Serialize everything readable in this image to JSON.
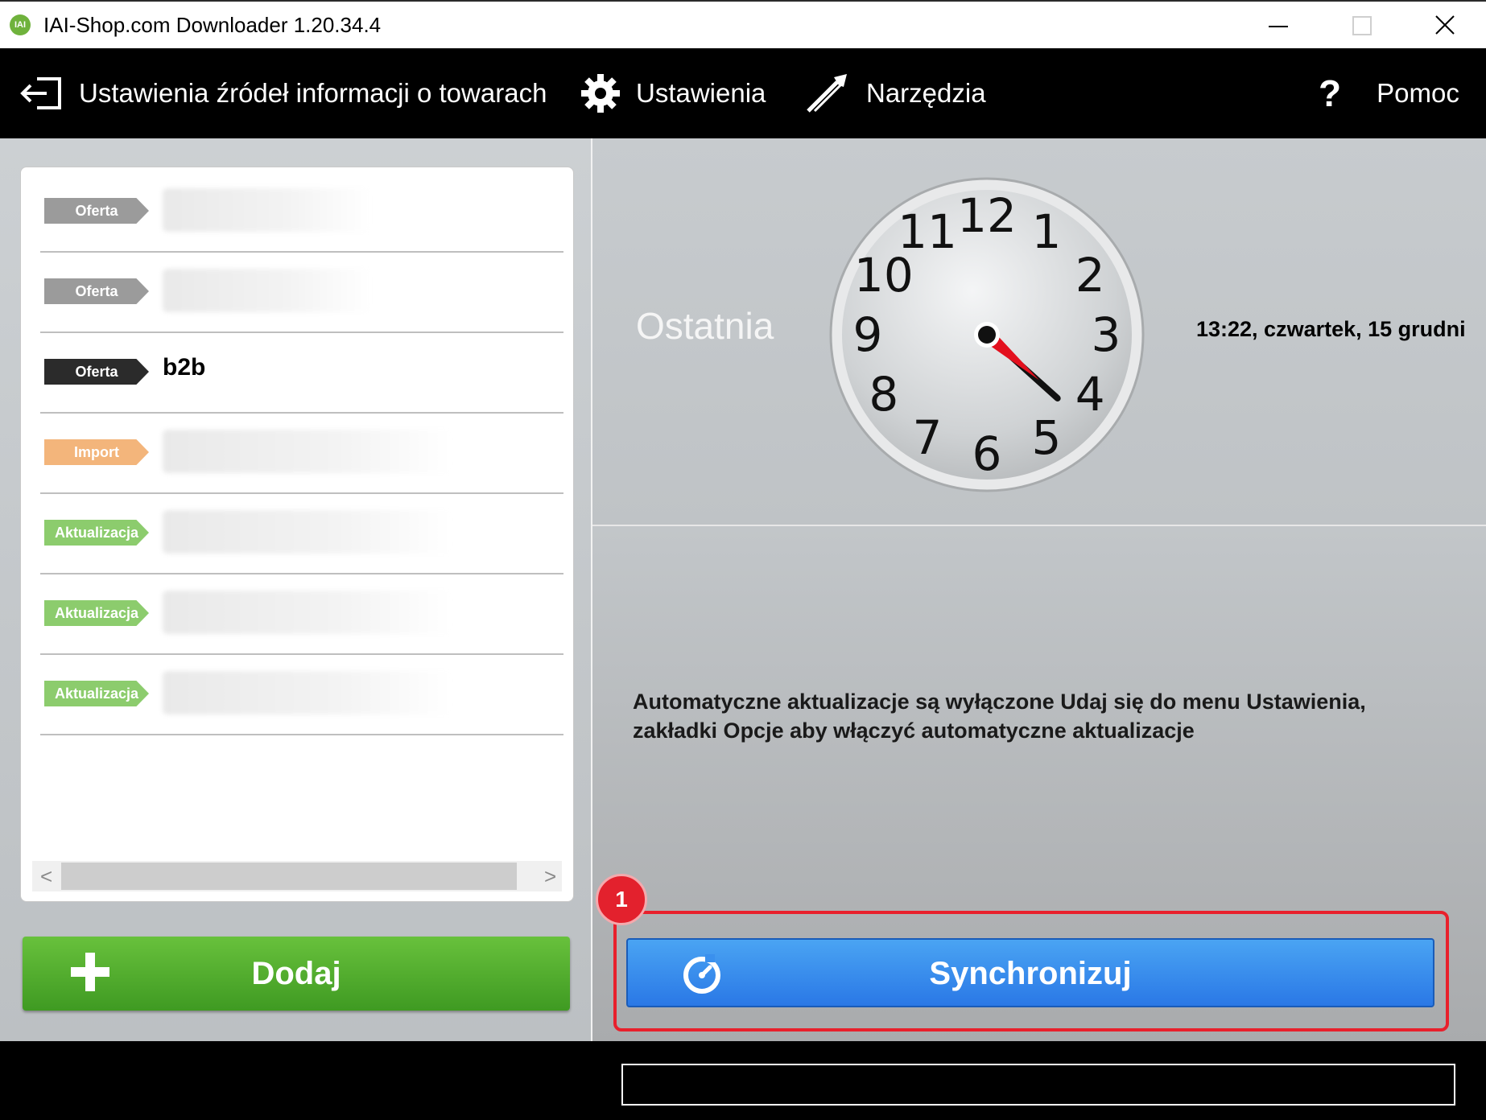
{
  "window": {
    "title": "IAI-Shop.com Downloader 1.20.34.4",
    "app_icon_text": "IAI"
  },
  "menu": {
    "sources_label": "Ustawienia źródeł informacji o towarach",
    "settings_label": "Ustawienia",
    "tools_label": "Narzędzia",
    "help_label": "Pomoc"
  },
  "source_list": [
    {
      "badge": "Oferta",
      "badge_color": "#9b9b9b",
      "name": "",
      "blurred": true
    },
    {
      "badge": "Oferta",
      "badge_color": "#9b9b9b",
      "name": "",
      "blurred": true
    },
    {
      "badge": "Oferta",
      "badge_color": "#2b2b2b",
      "name": "b2b",
      "blurred": false
    },
    {
      "badge": "Import",
      "badge_color": "#f3b57b",
      "name": "",
      "blurred": true
    },
    {
      "badge": "Aktualizacja",
      "badge_color": "#8ccc6d",
      "name": "",
      "blurred": true
    },
    {
      "badge": "Aktualizacja",
      "badge_color": "#8ccc6d",
      "name": "",
      "blurred": true
    },
    {
      "badge": "Aktualizacja",
      "badge_color": "#8ccc6d",
      "name": "",
      "blurred": true
    }
  ],
  "scroll": {
    "left_arrow": "<",
    "right_arrow": ">"
  },
  "add_button": {
    "label": "Dodaj",
    "icon": "plus-icon",
    "color": "#4fae2c"
  },
  "last_sync": {
    "label": "Ostatnia",
    "time_text": "13:22, czwartek, 15 grudni",
    "clock_numbers": [
      "12",
      "1",
      "2",
      "3",
      "4",
      "5",
      "6",
      "7",
      "8",
      "9",
      "10",
      "11"
    ],
    "clock_hour": 4,
    "clock_minute": 22
  },
  "info_message": "Automatyczne aktualizacje są wyłączone Udaj się do menu Ustawienia, zakładki Opcje aby włączyć automatyczne aktualizacje",
  "sync_button": {
    "label": "Synchronizuj",
    "icon": "sync-timer-icon",
    "color": "#3a90ee"
  },
  "step_marker": {
    "number": "1",
    "color": "#e3212d"
  },
  "status": {
    "progress": 0
  }
}
